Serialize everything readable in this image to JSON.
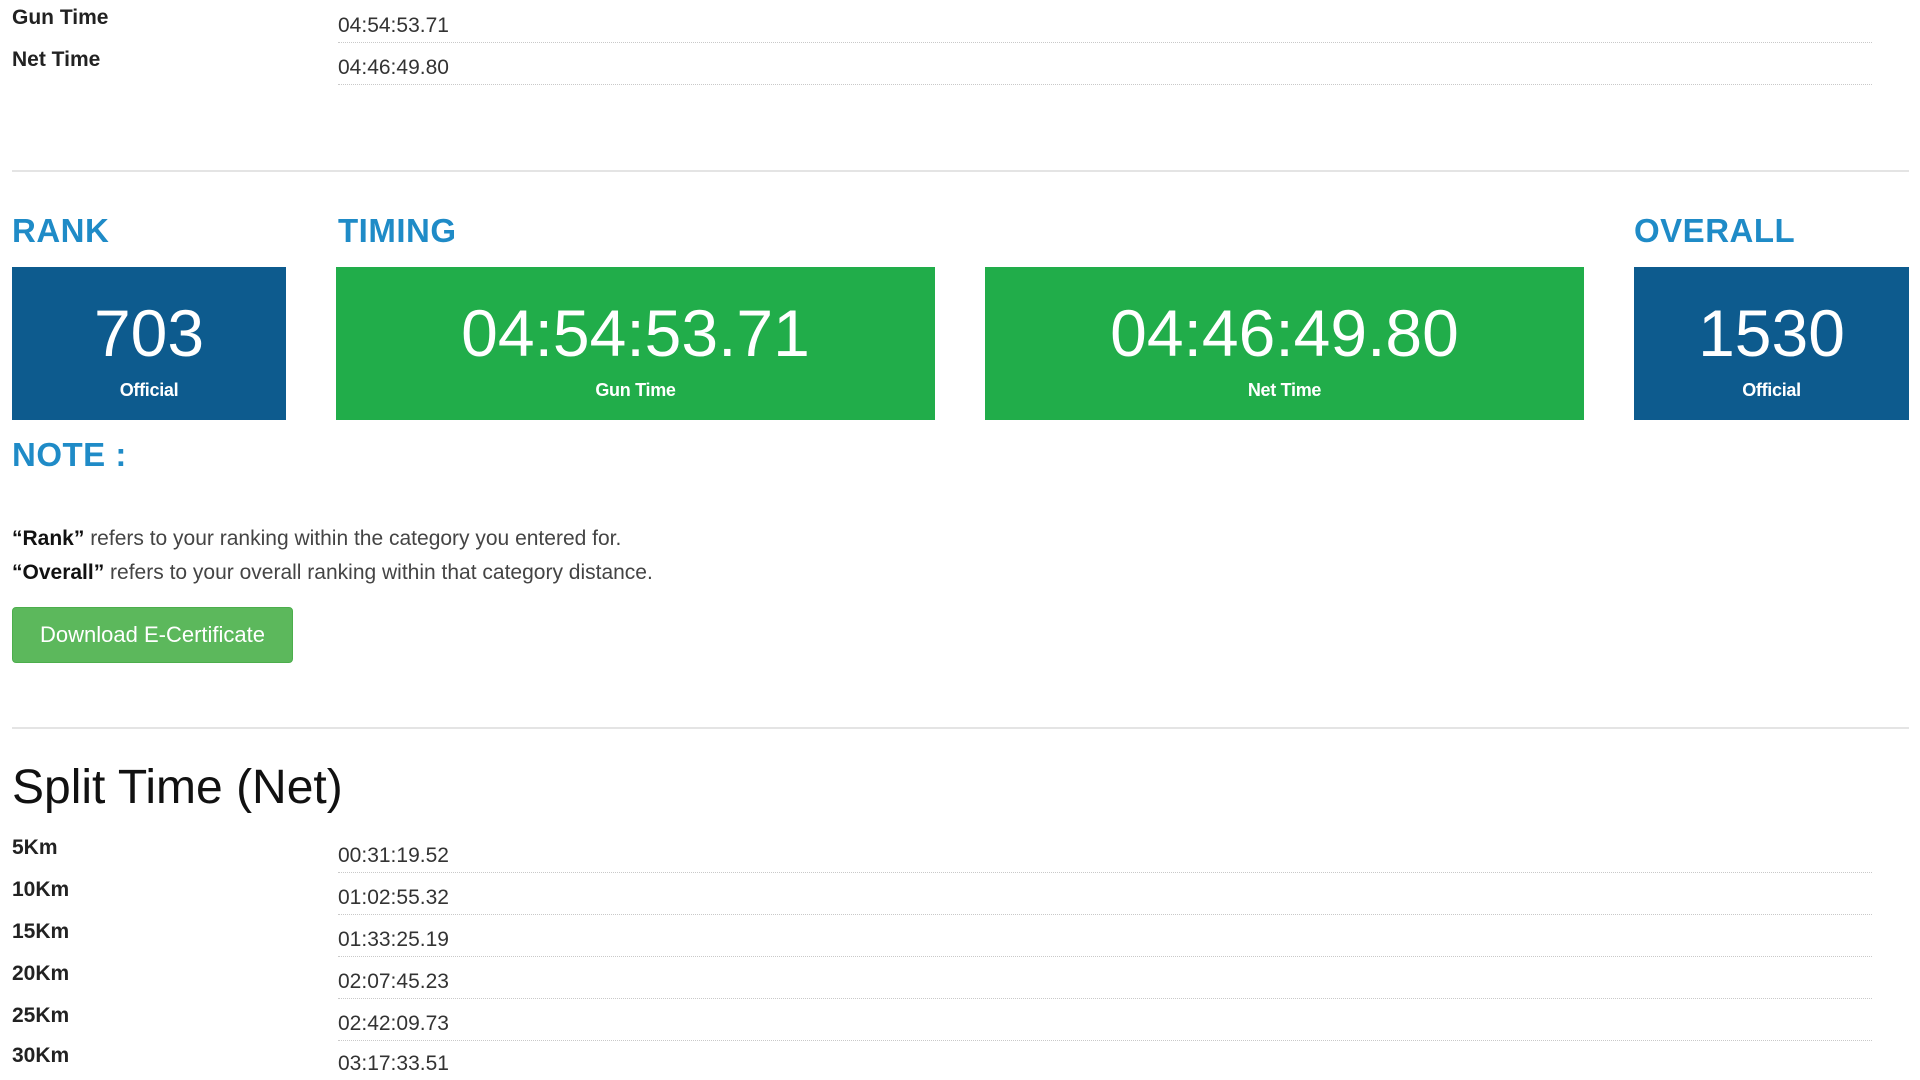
{
  "summary": {
    "rows": [
      {
        "label": "Gun Time",
        "value": "04:54:53.71"
      },
      {
        "label": "Net Time",
        "value": "04:46:49.80"
      }
    ]
  },
  "sections": {
    "rank_heading": "RANK",
    "timing_heading": "TIMING",
    "overall_heading": "OVERALL"
  },
  "stats": {
    "rank": {
      "value": "703",
      "caption": "Official"
    },
    "gun_time": {
      "value": "04:54:53.71",
      "caption": "Gun Time"
    },
    "net_time": {
      "value": "04:46:49.80",
      "caption": "Net Time"
    },
    "overall": {
      "value": "1530",
      "caption": "Official"
    }
  },
  "note": {
    "heading": "NOTE :",
    "rank_term": "“Rank”",
    "rank_text": " refers to your ranking within the category you entered for.",
    "overall_term": "“Overall”",
    "overall_text": " refers to your overall ranking within that category distance."
  },
  "actions": {
    "download_label": "Download E-Certificate"
  },
  "splits": {
    "title": "Split Time (Net)",
    "rows": [
      {
        "label": "5Km",
        "value": "00:31:19.52"
      },
      {
        "label": "10Km",
        "value": "01:02:55.32"
      },
      {
        "label": "15Km",
        "value": "01:33:25.19"
      },
      {
        "label": "20Km",
        "value": "02:07:45.23"
      },
      {
        "label": "25Km",
        "value": "02:42:09.73"
      },
      {
        "label": "30Km",
        "value": "03:17:33.51"
      }
    ]
  },
  "colors": {
    "heading_blue": "#1f8bc7",
    "rank_box": "#0d5b8e",
    "timing_box": "#21ad4a",
    "button_green": "#5cb85c"
  }
}
